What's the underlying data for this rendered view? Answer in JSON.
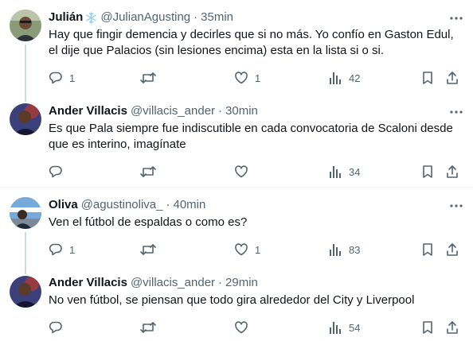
{
  "tweets": [
    {
      "name": "Julián",
      "badge_icon": "snowflake-icon",
      "handle": "@JulianAgusting",
      "separator": "·",
      "time": "35min",
      "text": "Hay que fingir demencia y decirles que si no más. Yo confío en Gaston Edul, el dije que Palacios (sin lesiones encima) esta en la lista si o si.",
      "replies": "1",
      "retweets": "",
      "likes": "1",
      "views": "42"
    },
    {
      "name": "Ander Villacis",
      "handle": "@villacis_ander",
      "separator": "·",
      "time": "30min",
      "text": "Es que Pala siempre fue indiscutible en cada convocatoria de Scaloni desde que es interino, imagínate",
      "replies": "",
      "retweets": "",
      "likes": "",
      "views": "34"
    },
    {
      "name": "Oliva",
      "handle": "@agustinoliva_",
      "separator": "·",
      "time": "40min",
      "text": "Ven el fútbol de espaldas o como es?",
      "replies": "1",
      "retweets": "",
      "likes": "1",
      "views": "83"
    },
    {
      "name": "Ander Villacis",
      "handle": "@villacis_ander",
      "separator": "·",
      "time": "29min",
      "text": "No ven fútbol, se piensan que todo gira alrededor del City y Liverpool",
      "replies": "",
      "retweets": "",
      "likes": "",
      "views": "54"
    }
  ],
  "colors": {
    "text": "#0f1419",
    "secondary": "#536471",
    "divider": "#eff3f4",
    "thread_line": "#cfd9de",
    "snowflake": "#8ecdf8"
  }
}
